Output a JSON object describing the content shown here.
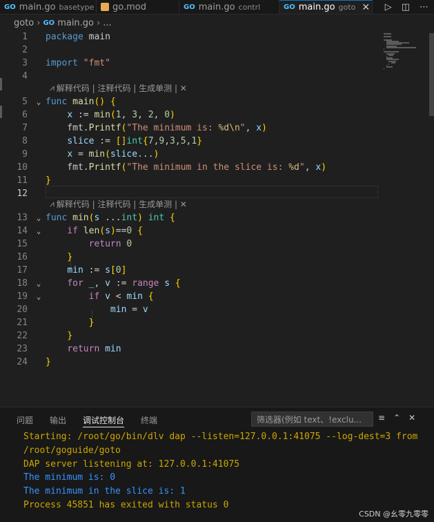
{
  "tabs": [
    {
      "icon": "GO",
      "name": "main.go",
      "desc": "basetype"
    },
    {
      "icon": "mod",
      "name": "go.mod",
      "desc": ""
    },
    {
      "icon": "GO",
      "name": "main.go",
      "desc": "contrl"
    },
    {
      "icon": "GO",
      "name": "main.go",
      "desc": "goto",
      "active": true,
      "close": "✕"
    }
  ],
  "breadcrumb": {
    "folder": "goto",
    "sep": "›",
    "file": "main.go",
    "tail": "..."
  },
  "codelens": {
    "label": "解释代码 | 注释代码 | 生成单测 | ✕"
  },
  "panel": {
    "tabs": [
      "问题",
      "输出",
      "调试控制台",
      "终端"
    ],
    "active_tab": "调试控制台",
    "filter_placeholder": "筛选器(例如 text、!exclu...",
    "console": [
      {
        "kind": "warn",
        "text": "Starting: /root/go/bin/dlv dap --listen=127.0.0.1:41075 --log-dest=3 from /root/goguide/goto"
      },
      {
        "kind": "warn",
        "text": "DAP server listening at: 127.0.0.1:41075"
      },
      {
        "kind": "info",
        "text": "The minimum is: 0"
      },
      {
        "kind": "info",
        "text": "The minimum in the slice is: 1"
      },
      {
        "kind": "warn",
        "text": "Process 45851 has exited with status 0"
      }
    ]
  },
  "watermark": "CSDN @幺零九零零",
  "code_lines": [
    "package main",
    "",
    "import \"fmt\"",
    "",
    "func main() {",
    "    x := min(1, 3, 2, 0)",
    "    fmt.Printf(\"The minimum is: %d\\n\", x)",
    "    slice := []int{7,9,3,5,1}",
    "    x = min(slice...)",
    "    fmt.Printf(\"The minimum in the slice is: %d\", x)",
    "}",
    "",
    "func min(s ...int) int {",
    "    if len(s)==0 {",
    "        return 0",
    "    }",
    "    min := s[0]",
    "    for _, v := range s {",
    "        if v < min {",
    "            min = v",
    "        }",
    "    }",
    "    return min",
    "}"
  ],
  "colors": {
    "keyword": "#569cd6",
    "function": "#dcdcaa",
    "string": "#ce9178",
    "number": "#b5cea8",
    "variable": "#9cdcfe",
    "type": "#4ec9b0",
    "control": "#c586c0",
    "accent": "#0078d4"
  },
  "icons": [
    "go-file-icon",
    "go-mod-icon",
    "close-icon",
    "run-icon",
    "split-editor-icon",
    "more-icon",
    "fold-chevron-icon",
    "codelens-icon",
    "clear-console-icon",
    "collapse-panel-icon"
  ]
}
